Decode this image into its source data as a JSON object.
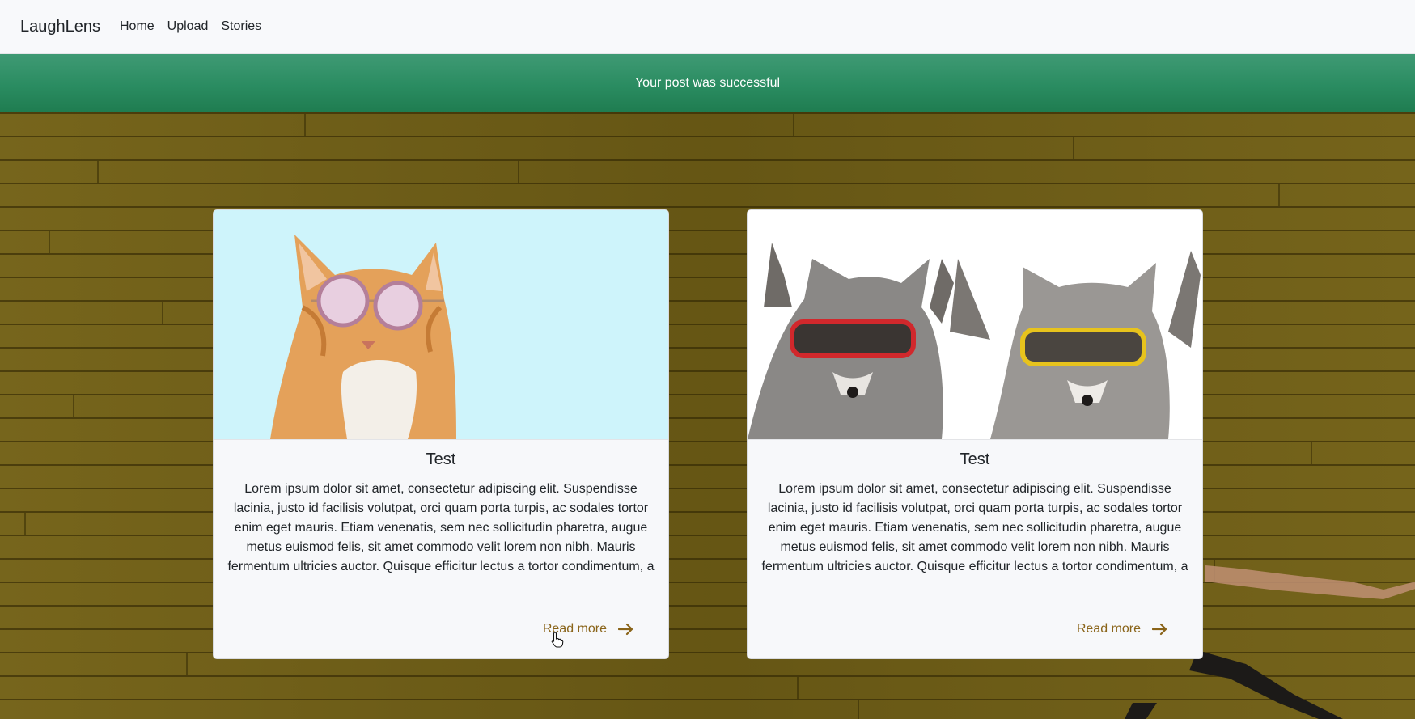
{
  "navbar": {
    "brand": "LaughLens",
    "links": [
      {
        "label": "Home"
      },
      {
        "label": "Upload"
      },
      {
        "label": "Stories"
      }
    ]
  },
  "alert": {
    "message": "Your post was successful",
    "color": "#2a8c61"
  },
  "cards": [
    {
      "image": "cat-with-sunglasses",
      "title": "Test",
      "body": "Lorem ipsum dolor sit amet, consectetur adipiscing elit. Suspendisse lacinia, justo id facilisis volutpat, orci quam porta turpis, ac sodales tortor enim eget mauris. Etiam venenatis, sem nec sollicitudin pharetra, augue metus euismod felis, sit amet commodo velit lorem non nibh. Mauris fermentum ultricies auctor. Quisque efficitur lectus a tortor condimentum, a consequat metus porttitor. Proin vulputate, augue at elementum ultricies, libero tellus tincidunt turpis, sed tincidunt justo nulla",
      "link_label": "Read more"
    },
    {
      "image": "raccoons-with-sunglasses",
      "title": "Test",
      "body": "Lorem ipsum dolor sit amet, consectetur adipiscing elit. Suspendisse lacinia, justo id facilisis volutpat, orci quam porta turpis, ac sodales tortor enim eget mauris. Etiam venenatis, sem nec sollicitudin pharetra, augue metus euismod felis, sit amet commodo velit lorem non nibh. Mauris fermentum ultricies auctor. Quisque efficitur lectus a tortor condimentum, a consequat metus porttitor. Proin vulputate, augue at elementum ultricies, libero tellus tincidunt turpis, sed tincidunt justo nulla",
      "link_label": "Read more"
    }
  ],
  "colors": {
    "link": "#8a6419",
    "background": "#6e5d16"
  }
}
